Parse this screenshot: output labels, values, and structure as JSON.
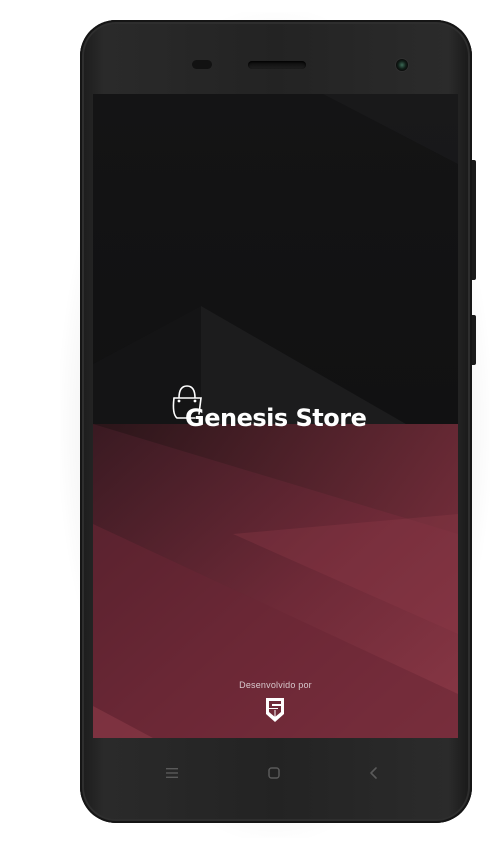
{
  "app": {
    "title": "Genesis Store"
  },
  "splash": {
    "brand_name": "Genesis Store",
    "developed_by_label": "Desenvolvido por",
    "logo_icon": "shopping-bag-icon",
    "developer_logo_icon": "shield-logo-icon"
  },
  "navigation_bar": {
    "buttons": [
      {
        "name": "menu",
        "icon": "menu-icon"
      },
      {
        "name": "home",
        "icon": "home-icon"
      },
      {
        "name": "back",
        "icon": "back-icon"
      }
    ]
  },
  "colors": {
    "screen_background": "#0f0f10",
    "accent_wine": "#7d2f3f",
    "phone_body": "#232323",
    "text_primary": "#ffffff"
  }
}
